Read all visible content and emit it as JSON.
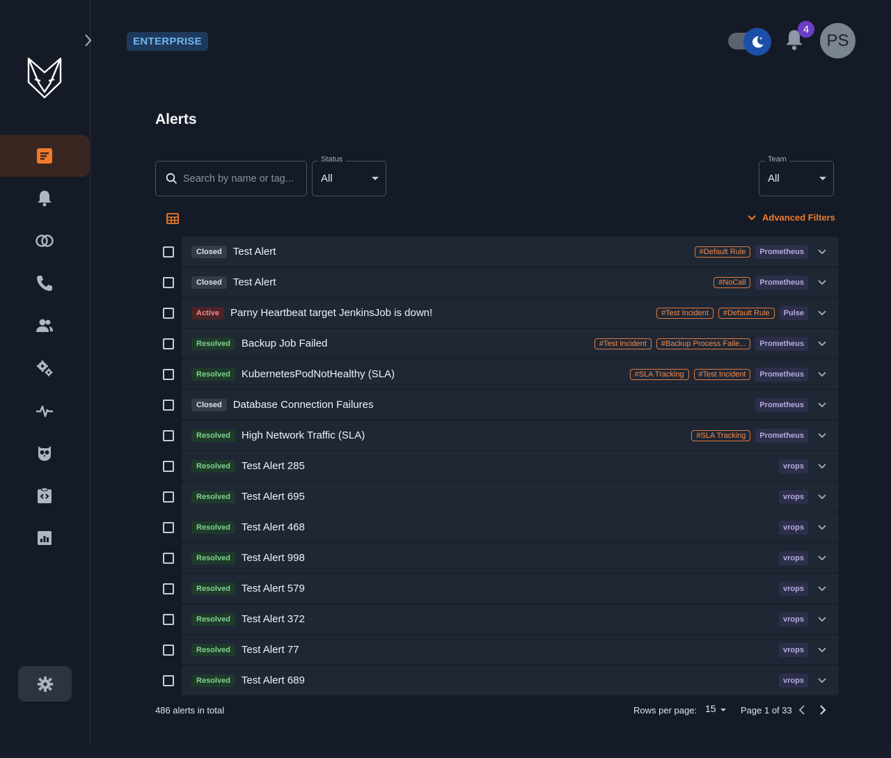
{
  "header": {
    "edition_badge": "ENTERPRISE",
    "notification_count": "4",
    "avatar_initials": "PS"
  },
  "sidebar": {
    "items": [
      {
        "icon": "alerts-list-icon",
        "active": true
      },
      {
        "icon": "bell-icon",
        "active": false
      },
      {
        "icon": "correlation-icon",
        "active": false
      },
      {
        "icon": "phone-icon",
        "active": false
      },
      {
        "icon": "users-icon",
        "active": false
      },
      {
        "icon": "gears-icon",
        "active": false
      },
      {
        "icon": "pulse-icon",
        "active": false
      },
      {
        "icon": "owl-icon",
        "active": false
      },
      {
        "icon": "code-clipboard-icon",
        "active": false
      },
      {
        "icon": "report-chart-icon",
        "active": false
      }
    ],
    "settings_icon": "gear-icon"
  },
  "main": {
    "title": "Alerts",
    "search": {
      "placeholder": "Search by name or tag..."
    },
    "status_filter": {
      "label": "Status",
      "value": "All"
    },
    "team_filter": {
      "label": "Team",
      "value": "All"
    },
    "advanced_filters_label": "Advanced Filters"
  },
  "colors": {
    "accent": "#f07a2a",
    "closed": "#353c48",
    "active": "#4a2426",
    "resolved": "#1e3a2a"
  },
  "alerts": [
    {
      "status": "Closed",
      "name": "Test Alert",
      "tags": [
        "#Default Rule"
      ],
      "source": "Prometheus"
    },
    {
      "status": "Closed",
      "name": "Test Alert",
      "tags": [
        "#NoCall"
      ],
      "source": "Prometheus"
    },
    {
      "status": "Active",
      "name": "Parny Heartbeat target JenkinsJob is down!",
      "tags": [
        "#Test Incident",
        "#Default Rule"
      ],
      "source": "Pulse"
    },
    {
      "status": "Resolved",
      "name": "Backup Job Failed",
      "tags": [
        "#Test Incident",
        "#Backup Process Faile..."
      ],
      "source": "Prometheus"
    },
    {
      "status": "Resolved",
      "name": "KubernetesPodNotHealthy (SLA)",
      "tags": [
        "#SLA Tracking",
        "#Test Incident"
      ],
      "source": "Prometheus"
    },
    {
      "status": "Closed",
      "name": "Database Connection Failures",
      "tags": [],
      "source": "Prometheus"
    },
    {
      "status": "Resolved",
      "name": "High Network Traffic (SLA)",
      "tags": [
        "#SLA Tracking"
      ],
      "source": "Prometheus"
    },
    {
      "status": "Resolved",
      "name": "Test Alert 285",
      "tags": [],
      "source": "vrops"
    },
    {
      "status": "Resolved",
      "name": "Test Alert 695",
      "tags": [],
      "source": "vrops"
    },
    {
      "status": "Resolved",
      "name": "Test Alert 468",
      "tags": [],
      "source": "vrops"
    },
    {
      "status": "Resolved",
      "name": "Test Alert 998",
      "tags": [],
      "source": "vrops"
    },
    {
      "status": "Resolved",
      "name": "Test Alert 579",
      "tags": [],
      "source": "vrops"
    },
    {
      "status": "Resolved",
      "name": "Test Alert 372",
      "tags": [],
      "source": "vrops"
    },
    {
      "status": "Resolved",
      "name": "Test Alert 77",
      "tags": [],
      "source": "vrops"
    },
    {
      "status": "Resolved",
      "name": "Test Alert 689",
      "tags": [],
      "source": "vrops"
    }
  ],
  "footer": {
    "total": "486 alerts in total",
    "rows_per_page_label": "Rows per page:",
    "rows_per_page": "15",
    "page_info": "Page 1 of 33"
  }
}
